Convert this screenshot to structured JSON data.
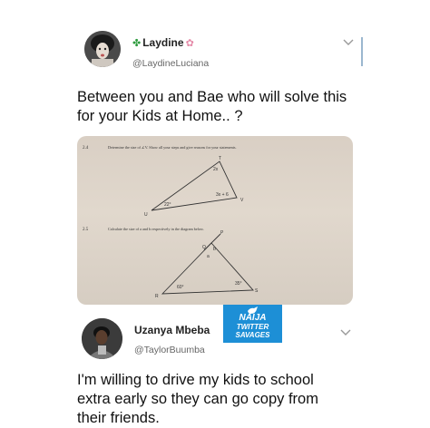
{
  "tweet1": {
    "name": "Laydine",
    "handle": "@LaydineLuciana",
    "name_prefix_icon": "clover-icon",
    "name_suffix_icon": "flower-icon",
    "text_line1": "Between you and Bae who will solve this",
    "text_line2": "for your Kids at Home.. ?"
  },
  "worksheet": {
    "q1_number": "2.4",
    "q1_text": "Determine the size of ∠V. Show all your steps and give reasons for your statements.",
    "q1_labels": {
      "T": "T",
      "U": "U",
      "V": "V",
      "angle_T": "2x",
      "angle_U": "22°",
      "angle_V": "3x + 6"
    },
    "q2_number": "2.5",
    "q2_text": "Calculate the size of a and b respectively in the diagram below.",
    "q2_labels": {
      "P": "P",
      "Q": "Q",
      "R": "R",
      "S": "S",
      "a": "a",
      "b": "b",
      "angle_R": "60°",
      "angle_S": "35°"
    }
  },
  "tweet2": {
    "name": "Uzanya Mbeba",
    "handle": "@TaylorBuumba",
    "text_line1": "I'm willing to drive my kids to school",
    "text_line2": "extra early so they can go copy from",
    "text_line3": "their friends."
  },
  "badge": {
    "line1": "NAIJA",
    "line2": "TWITTER",
    "line3": "SAVAGES",
    "color": "#1d8fd6",
    "icon": "bird-icon"
  },
  "colors": {
    "scrollbar": "#9bb7cf",
    "photo_bg": "#dcd3c8"
  }
}
